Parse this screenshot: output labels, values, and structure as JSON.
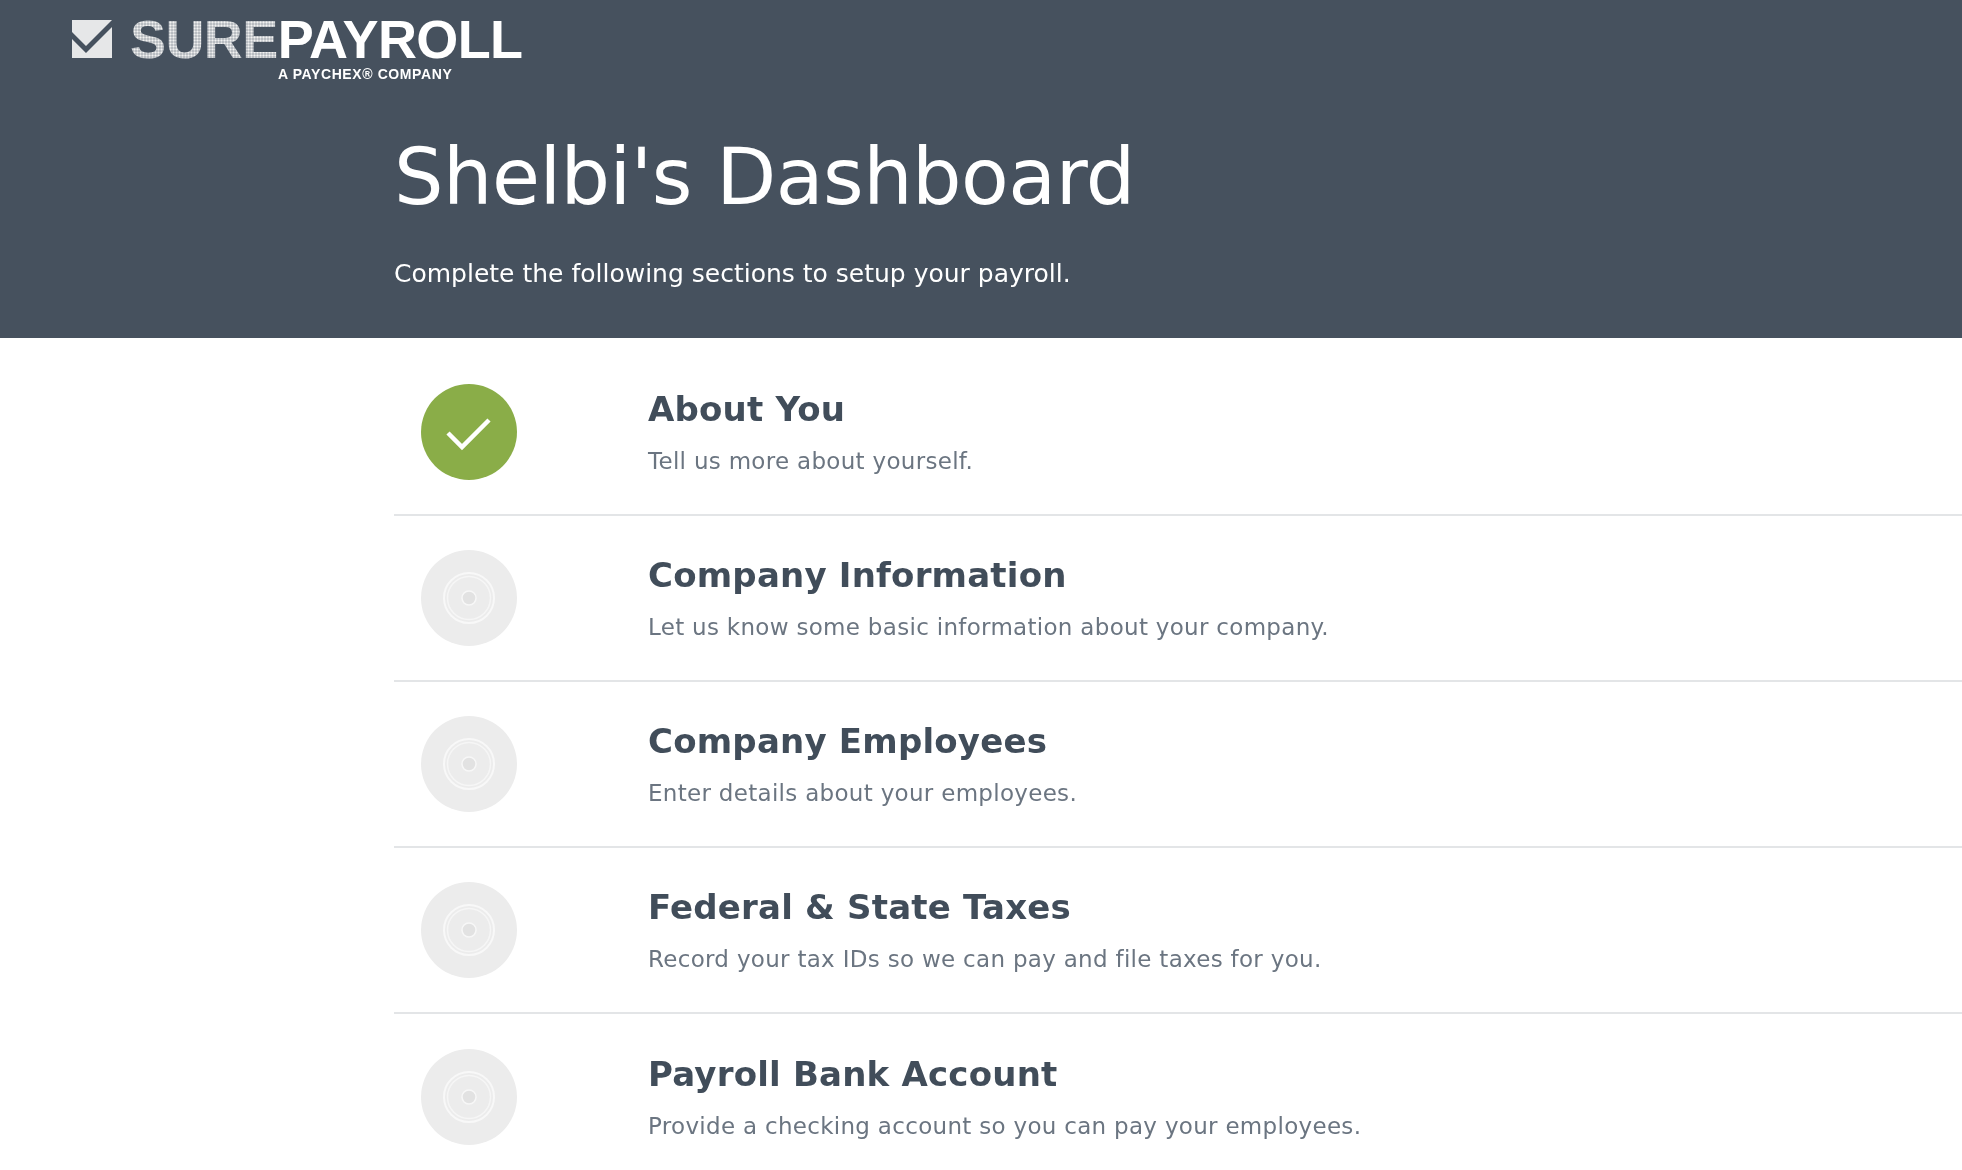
{
  "logo": {
    "brand_prefix": "SURE",
    "brand_name": "PAYROLL",
    "tagline": "A PAYCHEX® COMPANY"
  },
  "header": {
    "title": "Shelbi's Dashboard",
    "subtitle": "Complete the following sections to setup your payroll."
  },
  "sections": [
    {
      "title": "About You",
      "description": "Tell us more about yourself.",
      "completed": true
    },
    {
      "title": "Company Information",
      "description": "Let us know some basic information about your company.",
      "completed": false
    },
    {
      "title": "Company Employees",
      "description": "Enter details about your employees.",
      "completed": false
    },
    {
      "title": "Federal & State Taxes",
      "description": "Record your tax IDs so we can pay and file taxes for you.",
      "completed": false
    },
    {
      "title": "Payroll Bank Account",
      "description": "Provide a checking account so you can pay your employees.",
      "completed": false
    }
  ]
}
